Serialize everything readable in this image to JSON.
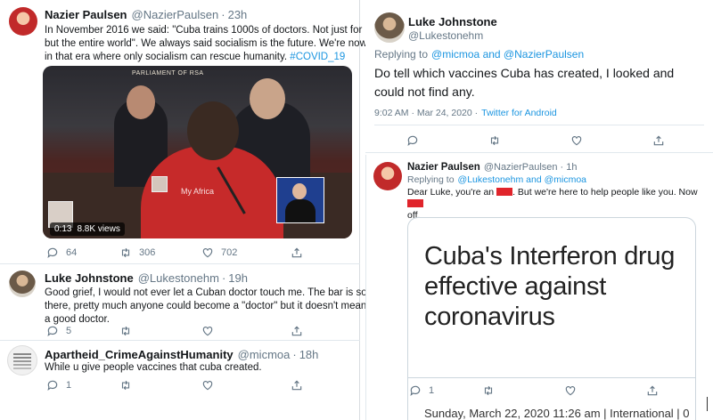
{
  "left": {
    "tweet1": {
      "name": "Nazier Paulsen",
      "handle": "@NazierPaulsen",
      "time": "23h",
      "text_lines": [
        "In November 2016 we said: \"Cuba trains 1000s of doctors. Not just for Cuba,",
        "but the entire world\". We always said socialism is the future. We're now living",
        "in that era where only socialism can rescue humanity."
      ],
      "hashtag": "#COVID_19",
      "video": {
        "logo_text": "PARLIAMENT OF RSA",
        "watermark": "My Africa",
        "duration": "0:13",
        "views": "8.8K views"
      },
      "stats": {
        "replies": "64",
        "retweets": "306",
        "likes": "702"
      }
    },
    "tweet2": {
      "name": "Luke Johnstone",
      "handle": "@Lukestonehm",
      "time": "19h",
      "text_lines": [
        "Good grief, I would not ever let a Cuban doctor touch me. The bar is so low",
        "there, pretty much anyone could become a \"doctor\" but it doesn't mean it's",
        "a good doctor."
      ],
      "stats": {
        "replies": "5"
      }
    },
    "tweet3": {
      "name": "Apartheid_CrimeAgainstHumanity",
      "handle": "@micmoa",
      "time": "18h",
      "text": "While u give people vaccines that cuba created.",
      "stats": {
        "replies": "1"
      }
    }
  },
  "right_top": {
    "name": "Luke Johnstone",
    "handle": "@Lukestonehm",
    "replying_prefix": "Replying to",
    "replying_to": "@micmoa and @NazierPaulsen",
    "text_lines": [
      "Do tell which vaccines Cuba has created, I looked and",
      "could not find any."
    ],
    "timestamp": "9:02 AM · Mar 24, 2020 ·",
    "source": "Twitter for Android"
  },
  "right_bottom": {
    "name": "Nazier Paulsen",
    "handle": "@NazierPaulsen",
    "time": "1h",
    "replying_prefix": "Replying to",
    "replying_to": "@Lukestonehm and @micmoa",
    "text_part1": "Dear Luke, you're an",
    "text_part2": ". But we're here to help people like you. Now",
    "text_part3": "off.",
    "card": {
      "headline": "Cuba's Interferon drug effective against coronavirus",
      "date": "Sunday, March 22, 2020 11:26 am | International | 0"
    },
    "stats": {
      "replies": "1"
    }
  }
}
